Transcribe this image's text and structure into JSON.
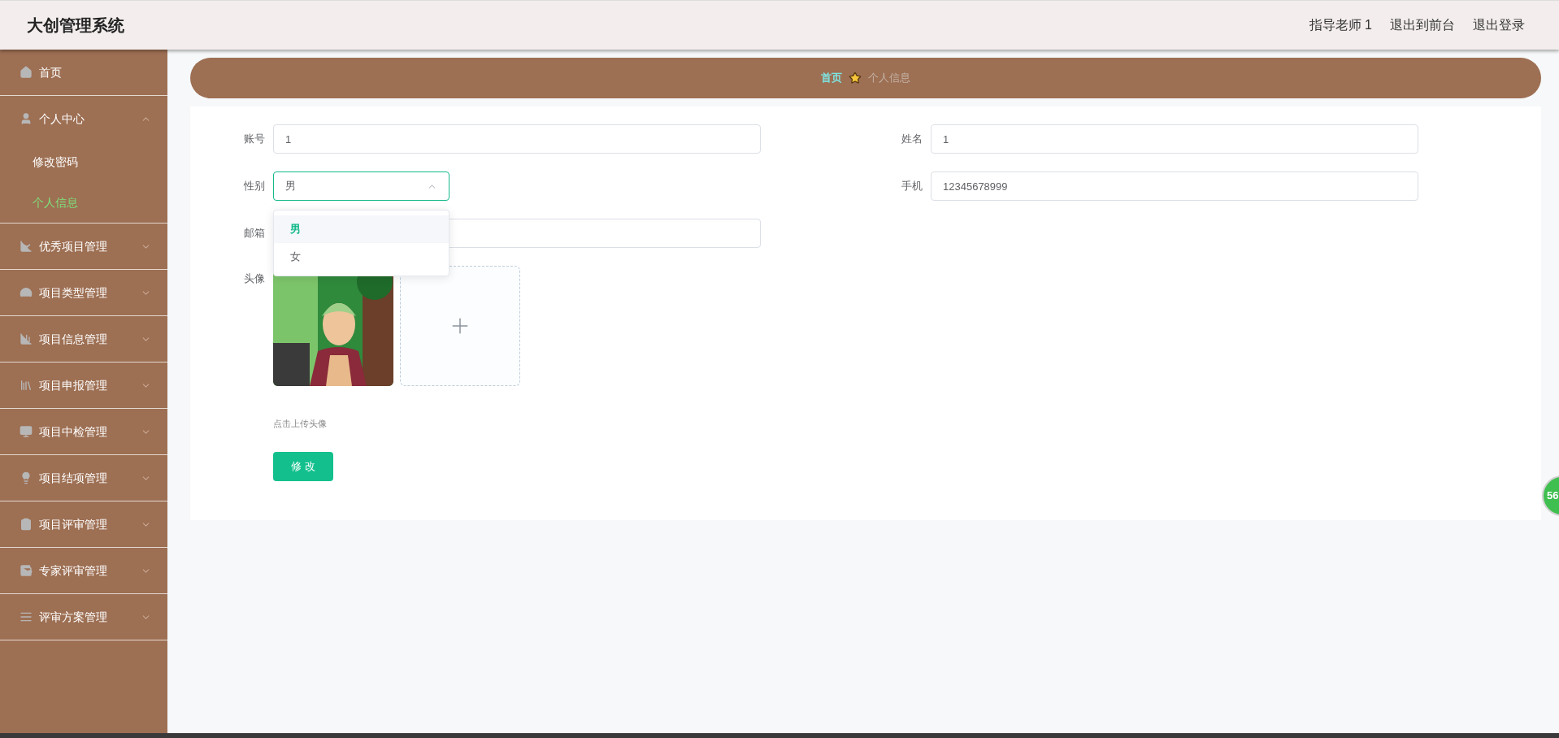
{
  "header": {
    "title": "大创管理系统",
    "links": [
      "指导老师 1",
      "退出到前台",
      "退出登录"
    ]
  },
  "sidebar": {
    "items": [
      {
        "label": "首页",
        "expandable": false
      },
      {
        "label": "个人中心",
        "expandable": true,
        "expanded": true,
        "children": [
          {
            "label": "修改密码",
            "selected": false
          },
          {
            "label": "个人信息",
            "selected": true
          }
        ]
      },
      {
        "label": "优秀项目管理",
        "expandable": true,
        "expanded": false
      },
      {
        "label": "项目类型管理",
        "expandable": true,
        "expanded": false
      },
      {
        "label": "项目信息管理",
        "expandable": true,
        "expanded": false
      },
      {
        "label": "项目申报管理",
        "expandable": true,
        "expanded": false
      },
      {
        "label": "项目中检管理",
        "expandable": true,
        "expanded": false
      },
      {
        "label": "项目结项管理",
        "expandable": true,
        "expanded": false
      },
      {
        "label": "项目评审管理",
        "expandable": true,
        "expanded": false
      },
      {
        "label": "专家评审管理",
        "expandable": true,
        "expanded": false
      },
      {
        "label": "评审方案管理",
        "expandable": true,
        "expanded": false
      }
    ]
  },
  "breadcrumb": {
    "home": "首页",
    "current": "个人信息"
  },
  "form": {
    "account": {
      "label": "账号",
      "value": "1"
    },
    "name": {
      "label": "姓名",
      "value": "1"
    },
    "gender": {
      "label": "性别",
      "value": "男",
      "open": true,
      "options": [
        {
          "label": "男",
          "selected": true
        },
        {
          "label": "女",
          "selected": false
        }
      ]
    },
    "phone": {
      "label": "手机",
      "value": "12345678999"
    },
    "email": {
      "label": "邮箱"
    },
    "avatar": {
      "label": "头像",
      "kind": "picture",
      "hint": "点击上传头像"
    },
    "submit": "修 改"
  },
  "badge": "56"
}
